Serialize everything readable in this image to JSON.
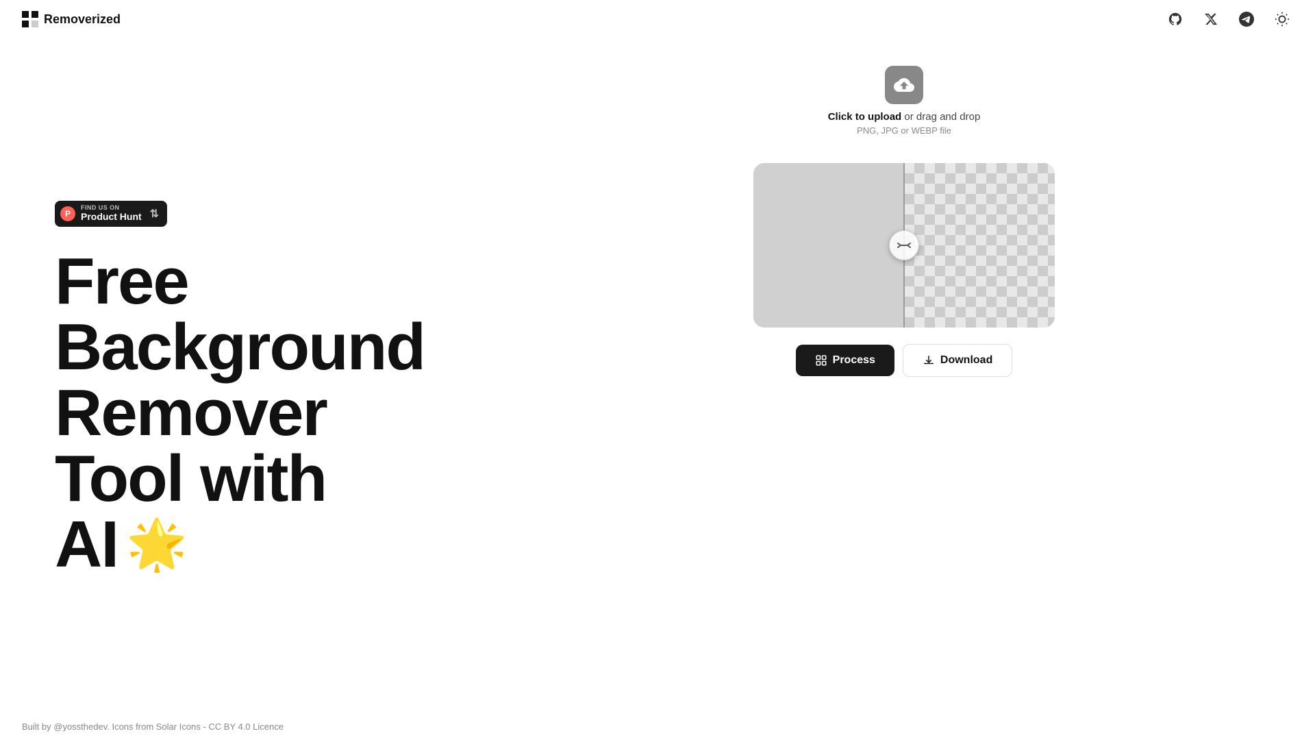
{
  "header": {
    "logo_text": "Removerized",
    "nav": {
      "github_label": "GitHub",
      "twitter_label": "Twitter / X",
      "telegram_label": "Telegram",
      "theme_label": "Toggle Theme"
    }
  },
  "product_hunt": {
    "find_us": "FIND US ON",
    "name": "Product Hunt",
    "icon_letter": "P"
  },
  "hero": {
    "line1": "Free",
    "line2": "Background",
    "line3": "Remover",
    "line4": "Tool with",
    "line5": "AI"
  },
  "upload": {
    "click_text": "Click to upload",
    "drag_text": " or drag and drop",
    "subtext": "PNG, JPG or WEBP file"
  },
  "buttons": {
    "process": "Process",
    "download": "Download"
  },
  "footer": {
    "text": "Built by @yossthedev. Icons from Solar Icons - CC BY 4.0 Licence"
  }
}
